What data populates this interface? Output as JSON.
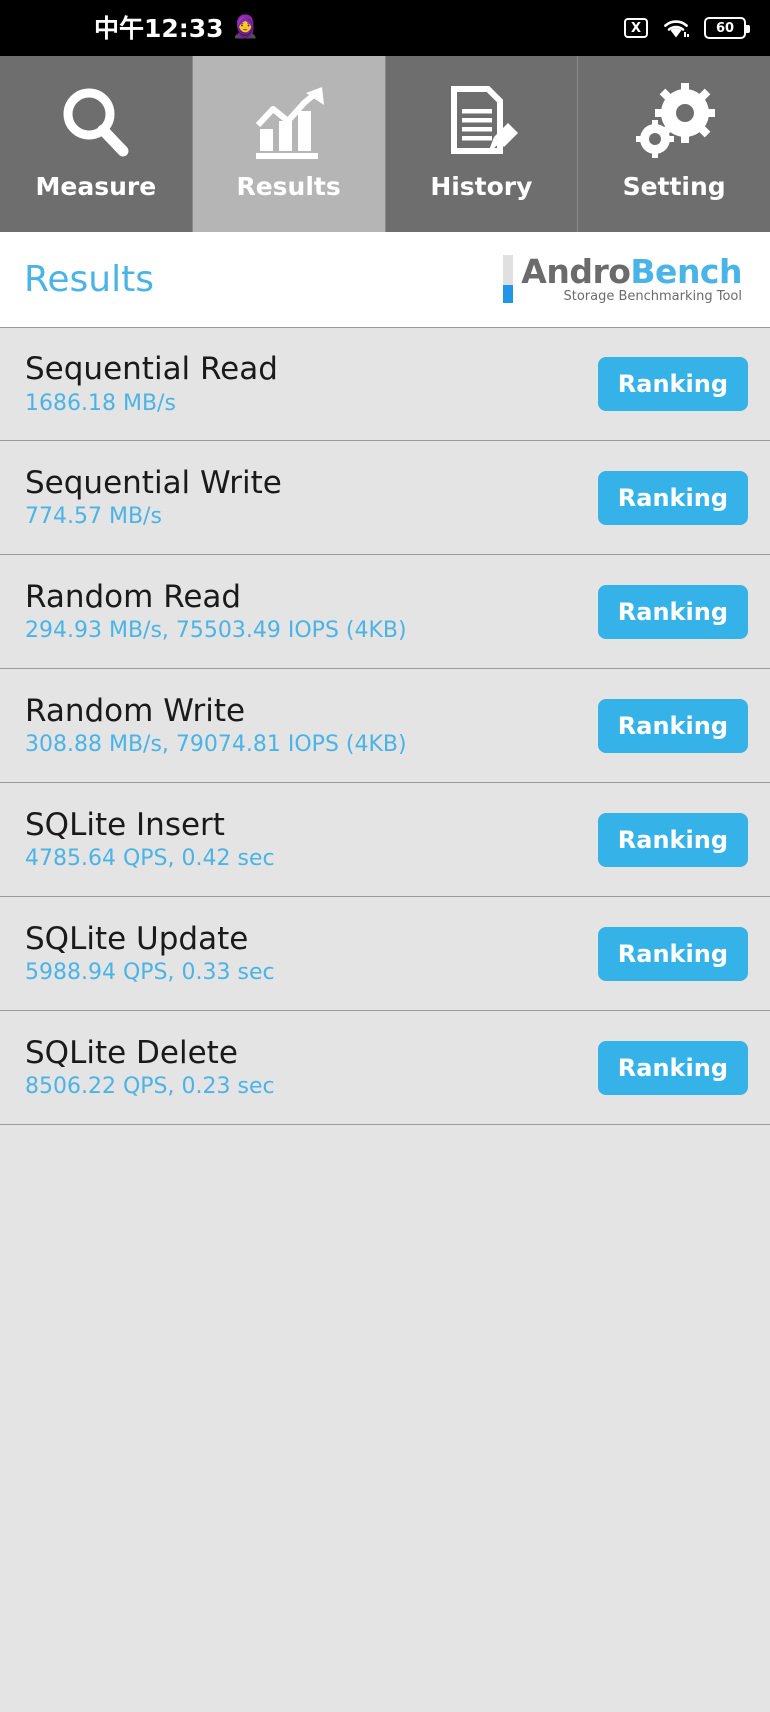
{
  "statusbar": {
    "time": "中午12:33",
    "emoji": "🧕",
    "icons": {
      "mute": "X",
      "wifi": "wifi-icon"
    },
    "battery_level": "60"
  },
  "tabs": [
    {
      "label": "Measure",
      "icon": "magnifier-icon",
      "active": false
    },
    {
      "label": "Results",
      "icon": "bar-chart-arrow-icon",
      "active": true
    },
    {
      "label": "History",
      "icon": "document-pencil-icon",
      "active": false
    },
    {
      "label": "Setting",
      "icon": "gears-icon",
      "active": false
    }
  ],
  "header": {
    "title": "Results",
    "logo_first": "Andro",
    "logo_second": "Bench",
    "logo_tagline": "Storage Benchmarking Tool"
  },
  "colors": {
    "accent_blue": "#4ab4e6",
    "button_blue": "#35b2e8",
    "logo_gray": "#6b6b6b",
    "tab_inactive": "#6e6e6e",
    "tab_active": "#b5b5b5",
    "list_bg": "#e4e4e4"
  },
  "results": [
    {
      "name": "Sequential Read",
      "value": "1686.18 MB/s",
      "button": "Ranking"
    },
    {
      "name": "Sequential Write",
      "value": "774.57 MB/s",
      "button": "Ranking"
    },
    {
      "name": "Random Read",
      "value": "294.93 MB/s, 75503.49 IOPS (4KB)",
      "button": "Ranking"
    },
    {
      "name": "Random Write",
      "value": "308.88 MB/s, 79074.81 IOPS (4KB)",
      "button": "Ranking"
    },
    {
      "name": "SQLite Insert",
      "value": "4785.64 QPS, 0.42 sec",
      "button": "Ranking"
    },
    {
      "name": "SQLite Update",
      "value": "5988.94 QPS, 0.33 sec",
      "button": "Ranking"
    },
    {
      "name": "SQLite Delete",
      "value": "8506.22 QPS, 0.23 sec",
      "button": "Ranking"
    }
  ]
}
